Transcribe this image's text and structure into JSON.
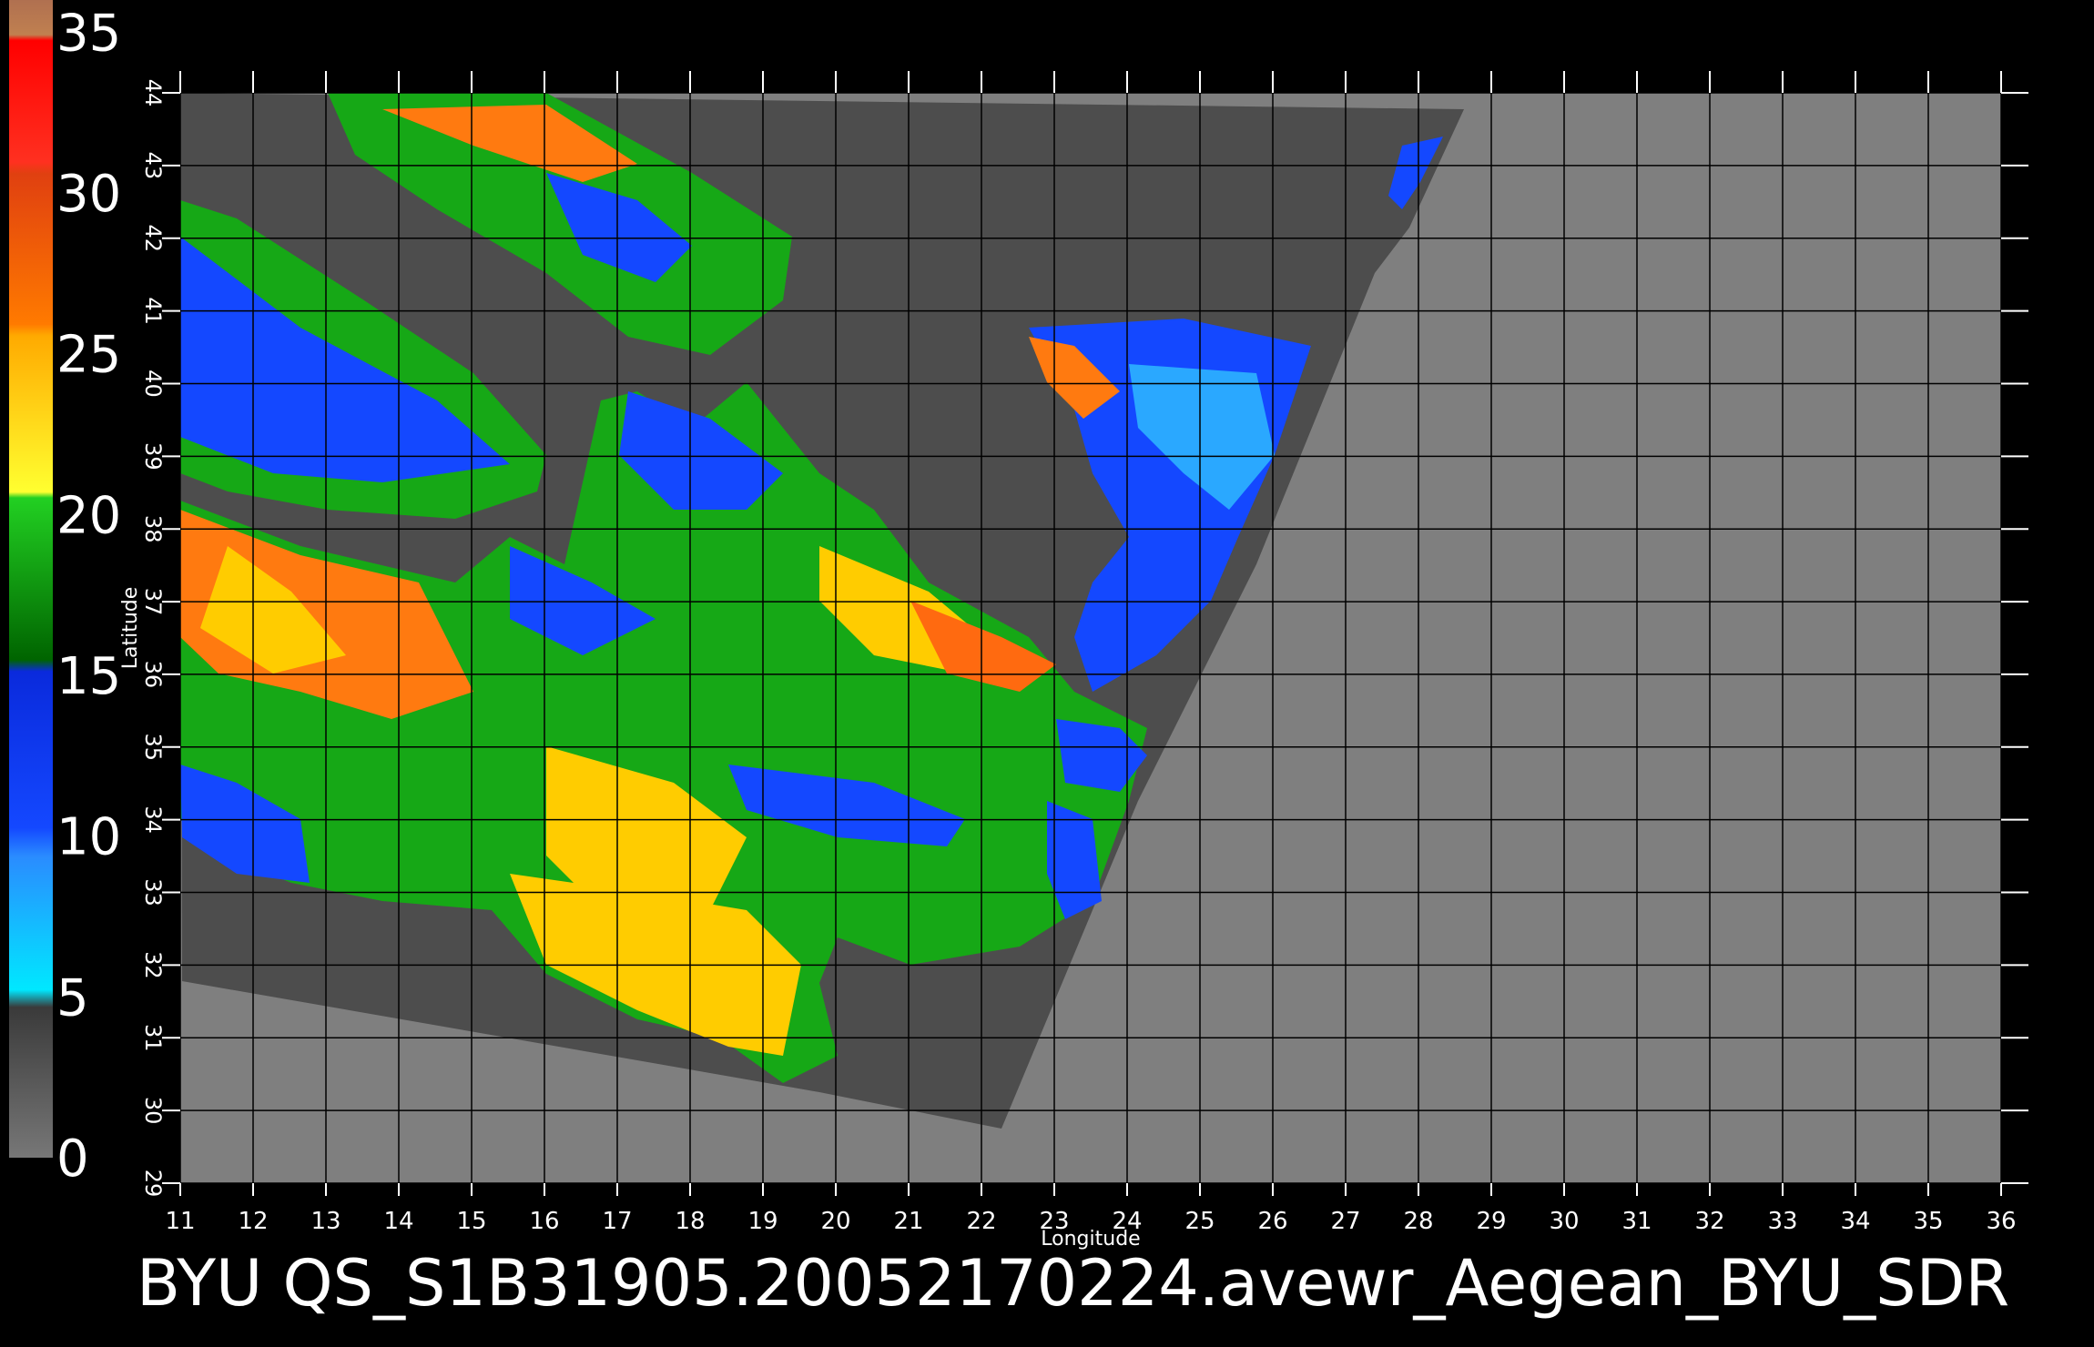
{
  "caption": "BYU  QS_S1B31905.20052170224.avewr_Aegean_BYU_SDR",
  "axes": {
    "xlabel": "Longitude",
    "ylabel": "Latitude",
    "xlim": [
      11,
      36
    ],
    "ylim": [
      29,
      44
    ],
    "x_ticks": [
      "11",
      "12",
      "13",
      "14",
      "15",
      "16",
      "17",
      "18",
      "19",
      "20",
      "21",
      "22",
      "23",
      "24",
      "25",
      "26",
      "27",
      "28",
      "29",
      "30",
      "31",
      "32",
      "33",
      "34",
      "35",
      "36"
    ],
    "y_ticks": [
      "29",
      "30",
      "31",
      "32",
      "33",
      "34",
      "35",
      "36",
      "37",
      "38",
      "39",
      "40",
      "41",
      "42",
      "43",
      "44"
    ],
    "grid": true
  },
  "colorbar": {
    "labels": [
      "35",
      "30",
      "25",
      "20",
      "15",
      "10",
      "5",
      "0"
    ],
    "bands": [
      {
        "from": 0,
        "to": 5,
        "color": "#6a6a6a"
      },
      {
        "from": 5,
        "to": 10,
        "color": "#2aa8ff"
      },
      {
        "from": 10,
        "to": 15,
        "color": "#1040f0"
      },
      {
        "from": 15,
        "to": 20,
        "color": "#109a10"
      },
      {
        "from": 20,
        "to": 25,
        "color": "#ffcc00"
      },
      {
        "from": 25,
        "to": 30,
        "color": "#ff6a10"
      },
      {
        "from": 30,
        "to": 35,
        "color": "#f01010"
      },
      {
        "from": 35,
        "to": 36,
        "color": "#c07040"
      }
    ]
  },
  "colors": {
    "background": "#000000",
    "land_mask": "#4d4d4d",
    "no_data": "#7f7f7f",
    "grid": "#000000",
    "wind_vector": "#111111"
  }
}
